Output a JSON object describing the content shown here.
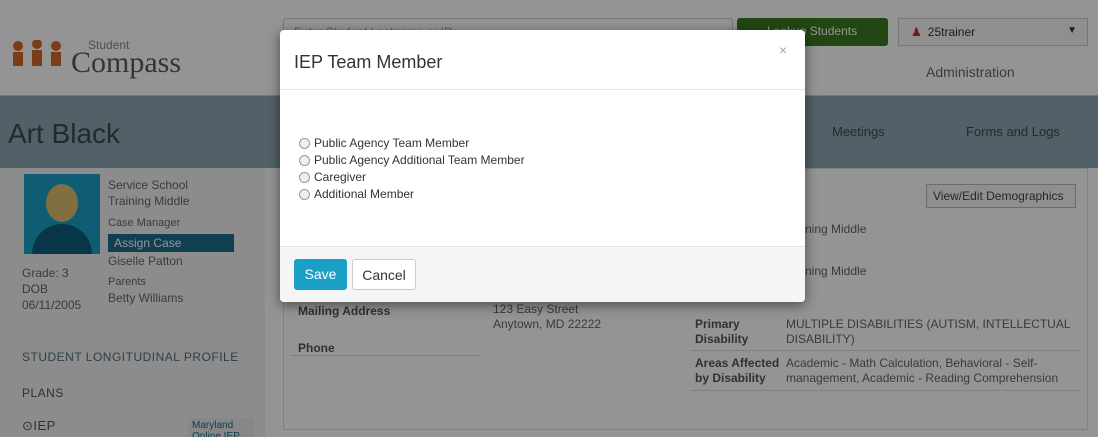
{
  "header": {
    "logo_small": "Student",
    "logo_big": "Compass",
    "search_placeholder": "Enter Student Lastname or ID",
    "lookup_label": "Lookup Students",
    "user_label": "25trainer",
    "admin_label": "Administration"
  },
  "student": {
    "name": "Art Black",
    "school_label": "Service School",
    "school_value": "Training Middle",
    "case_manager_label": "Case Manager",
    "assign_label": "Assign Case Manager",
    "case_manager_value": "Giselle Patton",
    "grade": "Grade: 3",
    "dob_label": "DOB",
    "dob": "06/11/2005",
    "parents_label": "Parents",
    "parents_value": "Betty Williams",
    "profile_link": "STUDENT LONGITUDINAL PROFILE",
    "plans_link": "PLANS",
    "iep_link": "⊙IEP",
    "badge": "Maryland Online IEP"
  },
  "tabs": {
    "meetings": "Meetings",
    "forms": "Forms and Logs"
  },
  "content": {
    "view_edit": "View/Edit Demographics",
    "school1": "ning Middle",
    "school2": "ning Middle",
    "mailing_label": "Mailing Address",
    "address_line1": "123 Easy Street",
    "address_line2": "Anytown, MD 22222",
    "phone_label": "Phone",
    "primary_label_1": "Primary",
    "primary_label_2": "Disability",
    "primary_value_1": "MULTIPLE DISABILITIES (AUTISM, INTELLECTUAL",
    "primary_value_2": "DISABILITY)",
    "areas_label_1": "Areas Affected",
    "areas_label_2": "by Disability",
    "areas_value_1": "Academic - Math Calculation, Behavioral - Self-",
    "areas_value_2": "management, Academic - Reading Comprehension"
  },
  "modal": {
    "title": "IEP Team Member",
    "close": "×",
    "options": [
      "Public Agency Team Member",
      "Public Agency Additional Team Member",
      "Caregiver",
      "Additional Member"
    ],
    "save_label": "Save",
    "cancel_label": "Cancel"
  }
}
